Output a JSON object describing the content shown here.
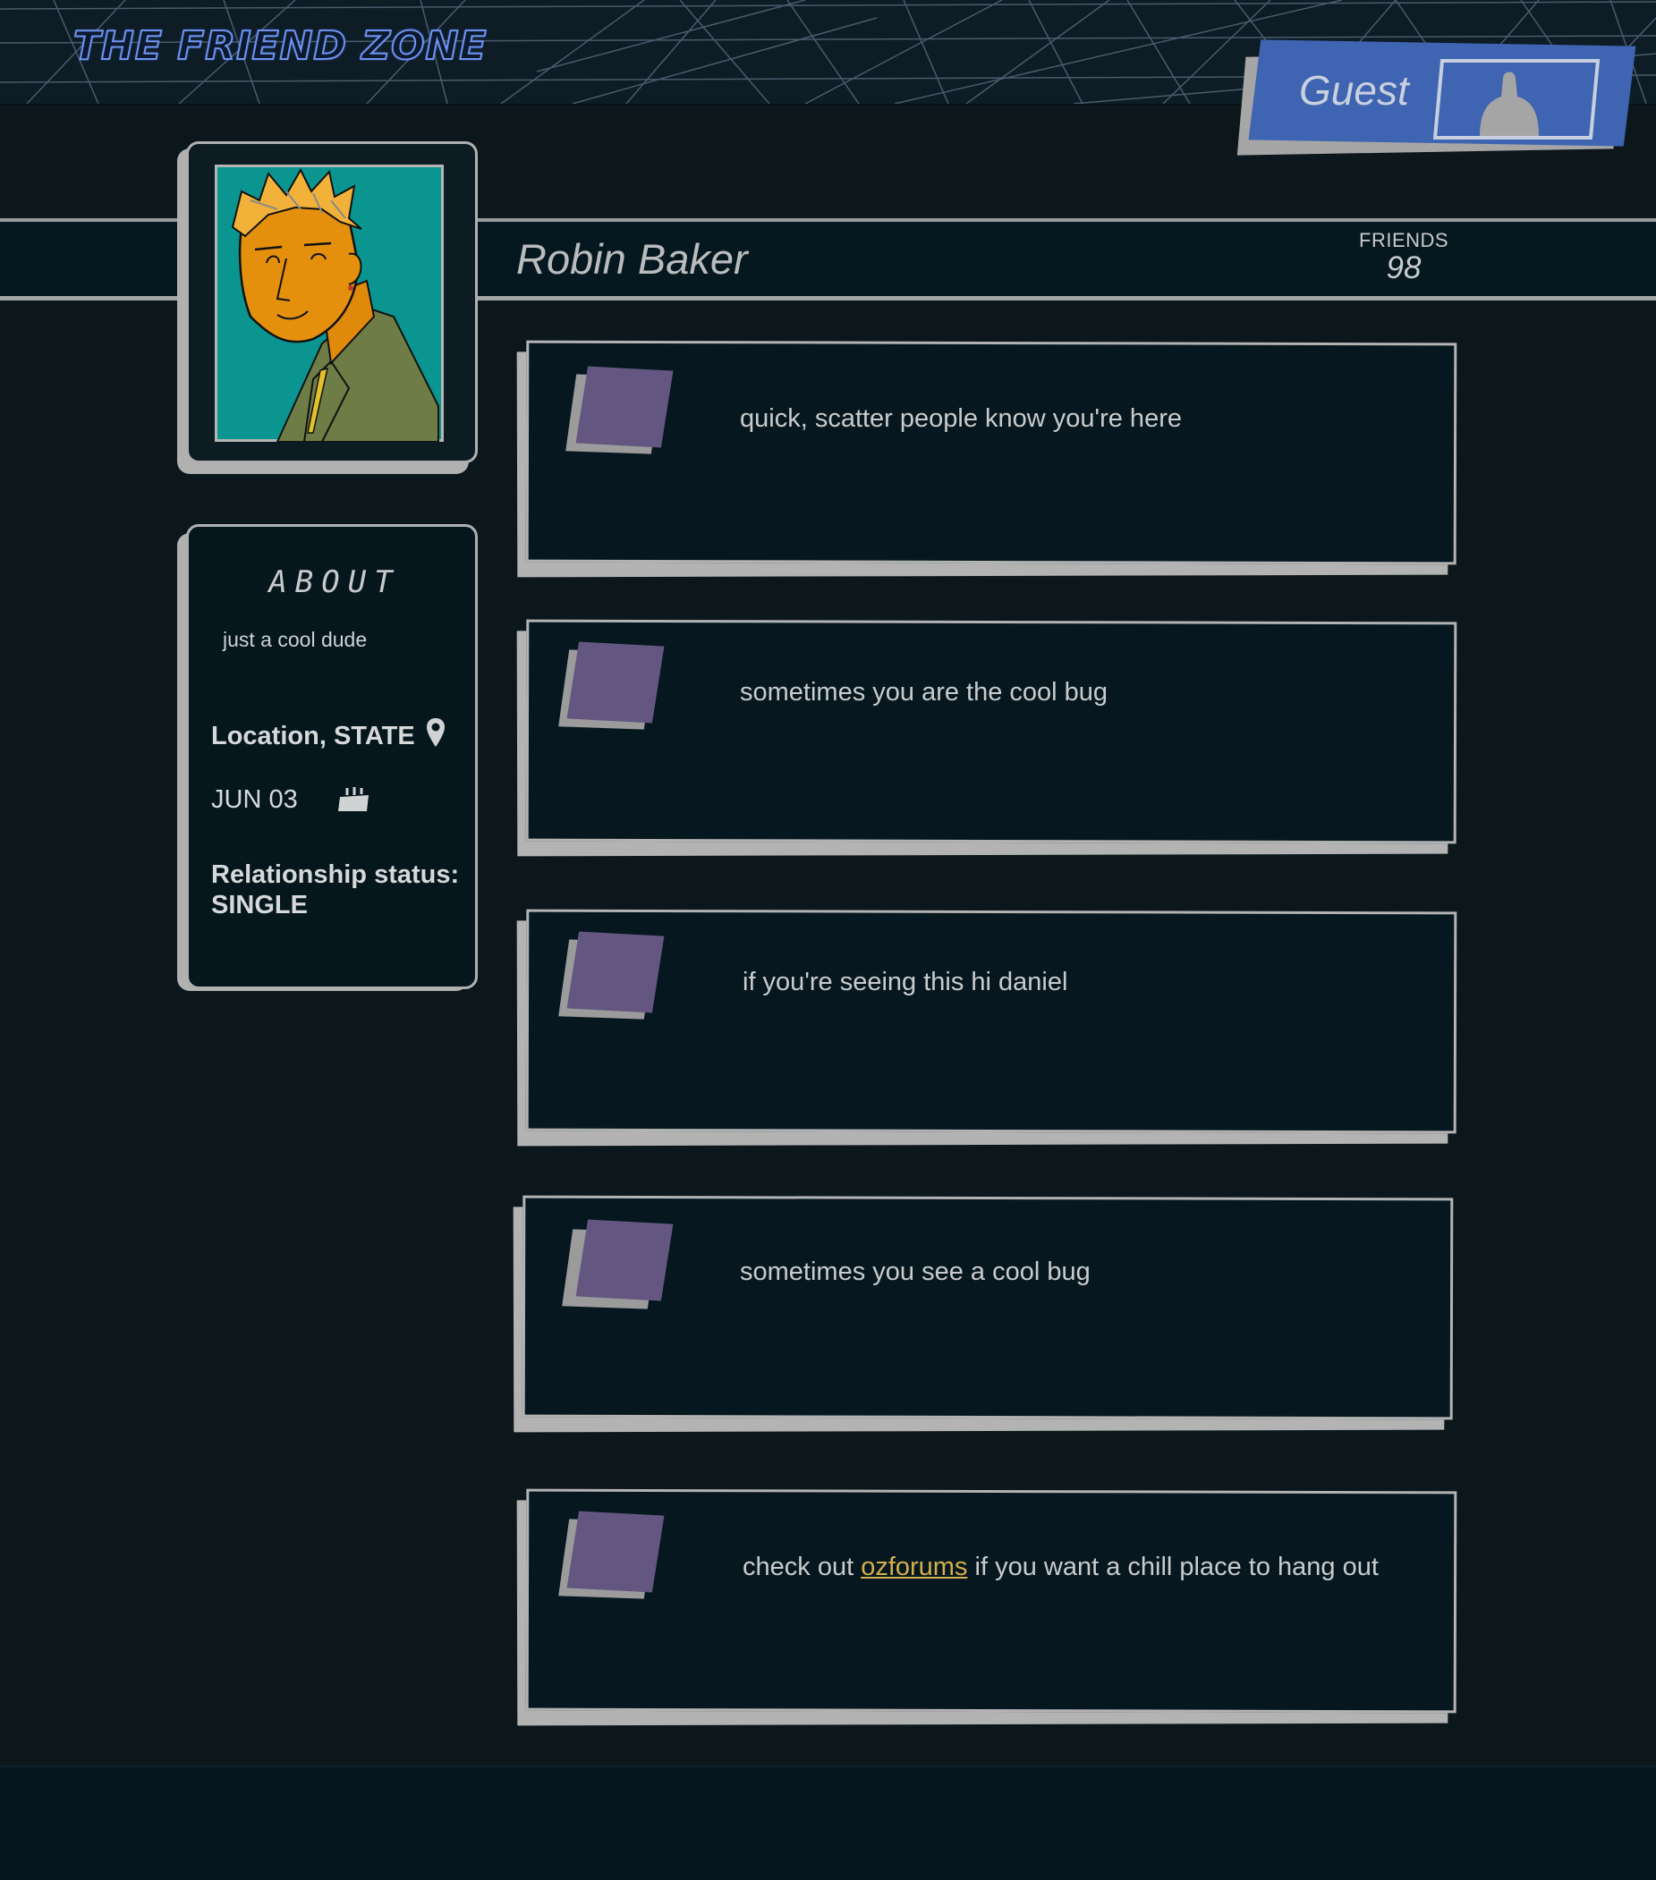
{
  "site": {
    "title": "THE FRIEND ZONE"
  },
  "user_badge": {
    "label": "Guest",
    "avatar_icon": "user-silhouette-icon"
  },
  "profile": {
    "name": "Robin Baker",
    "friends_label": "FRIENDS",
    "friends_count": "98",
    "avatar_icon": "profile-portrait"
  },
  "about": {
    "title": "ABOUT",
    "bio": "just a cool dude",
    "location": "Location, STATE",
    "location_icon": "map-pin-icon",
    "birthday": "JUN 03",
    "birthday_icon": "birthday-cake-icon",
    "relationship_label": "Relationship status:",
    "relationship_value": "SINGLE"
  },
  "posts": [
    {
      "text": "quick, scatter people know you're here"
    },
    {
      "text": "sometimes you are the cool bug"
    },
    {
      "text": "if you're seeing this hi daniel"
    },
    {
      "text": "sometimes you see a cool bug"
    },
    {
      "text_before": "check out ",
      "link": "ozforums",
      "text_after": " if you want a chill place to hang out"
    }
  ],
  "colors": {
    "background": "#0b171b",
    "card": "#06171f",
    "card_border": "#b3b3b3",
    "guest_badge": "#3e64b2",
    "post_avatar": "#635781",
    "link": "#d3b04a",
    "title_outline": "#6f93f2"
  }
}
